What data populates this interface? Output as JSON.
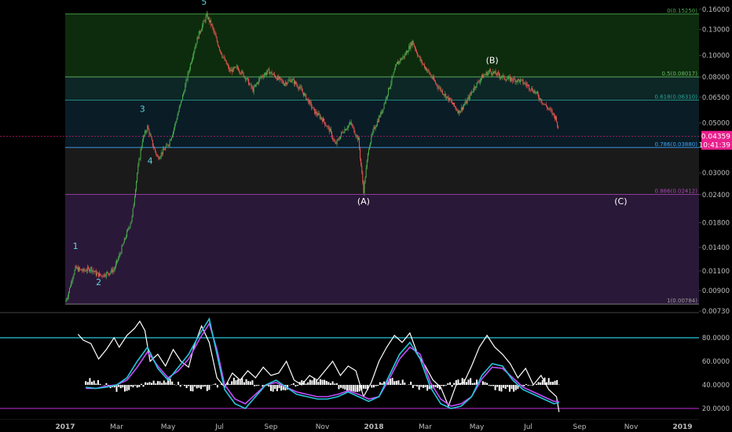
{
  "chart_data": [
    {
      "type": "candlestick",
      "scale": "log",
      "ylim": [
        0.0073,
        0.165
      ],
      "y_ticks": [
        "0.16000",
        "0.13000",
        "0.10000",
        "0.08000",
        "0.06500",
        "0.05000",
        "0.03900",
        "0.03000",
        "0.02400",
        "0.01800",
        "0.01400",
        "0.01100",
        "0.00900",
        "0.00730"
      ],
      "y_tick_values": [
        0.16,
        0.13,
        0.1,
        0.08,
        0.065,
        0.05,
        0.039,
        0.03,
        0.024,
        0.018,
        0.014,
        0.011,
        0.009,
        0.0073
      ],
      "x_ticks": [
        "2017",
        "Mar",
        "May",
        "Jul",
        "Sep",
        "Nov",
        "2018",
        "Mar",
        "May",
        "Jul",
        "Sep",
        "Nov",
        "2019"
      ],
      "x_tick_months": [
        0,
        2,
        4,
        6,
        8,
        10,
        12,
        14,
        16,
        18,
        20,
        22,
        24
      ],
      "price_path": [
        [
          0,
          0.008
        ],
        [
          0.1,
          0.0086
        ],
        [
          0.3,
          0.0105
        ],
        [
          0.4,
          0.0113
        ],
        [
          0.7,
          0.011
        ],
        [
          1.0,
          0.0113
        ],
        [
          1.2,
          0.0107
        ],
        [
          1.4,
          0.0105
        ],
        [
          1.7,
          0.0108
        ],
        [
          1.9,
          0.0112
        ],
        [
          2.1,
          0.0128
        ],
        [
          2.3,
          0.015
        ],
        [
          2.6,
          0.019
        ],
        [
          2.8,
          0.03
        ],
        [
          3.0,
          0.042
        ],
        [
          3.2,
          0.048
        ],
        [
          3.4,
          0.04
        ],
        [
          3.6,
          0.035
        ],
        [
          3.8,
          0.0375
        ],
        [
          4.0,
          0.04
        ],
        [
          4.2,
          0.046
        ],
        [
          4.4,
          0.056
        ],
        [
          4.6,
          0.068
        ],
        [
          4.8,
          0.085
        ],
        [
          5.0,
          0.105
        ],
        [
          5.2,
          0.125
        ],
        [
          5.5,
          0.15
        ],
        [
          5.7,
          0.135
        ],
        [
          5.9,
          0.115
        ],
        [
          6.1,
          0.1
        ],
        [
          6.4,
          0.085
        ],
        [
          6.7,
          0.088
        ],
        [
          7.0,
          0.08
        ],
        [
          7.3,
          0.07
        ],
        [
          7.6,
          0.08
        ],
        [
          7.9,
          0.085
        ],
        [
          8.2,
          0.08
        ],
        [
          8.5,
          0.075
        ],
        [
          8.8,
          0.078
        ],
        [
          9.1,
          0.072
        ],
        [
          9.4,
          0.064
        ],
        [
          9.7,
          0.056
        ],
        [
          10.0,
          0.052
        ],
        [
          10.3,
          0.046
        ],
        [
          10.5,
          0.04
        ],
        [
          10.8,
          0.046
        ],
        [
          11.1,
          0.05
        ],
        [
          11.4,
          0.042
        ],
        [
          11.6,
          0.025
        ],
        [
          11.8,
          0.039
        ],
        [
          12.0,
          0.047
        ],
        [
          12.3,
          0.056
        ],
        [
          12.6,
          0.072
        ],
        [
          12.9,
          0.092
        ],
        [
          13.2,
          0.1
        ],
        [
          13.5,
          0.115
        ],
        [
          13.8,
          0.095
        ],
        [
          14.1,
          0.085
        ],
        [
          14.4,
          0.075
        ],
        [
          14.7,
          0.068
        ],
        [
          15.0,
          0.062
        ],
        [
          15.3,
          0.056
        ],
        [
          15.6,
          0.062
        ],
        [
          15.9,
          0.072
        ],
        [
          16.2,
          0.08
        ],
        [
          16.5,
          0.085
        ],
        [
          16.8,
          0.082
        ],
        [
          17.1,
          0.079
        ],
        [
          17.4,
          0.078
        ],
        [
          17.7,
          0.077
        ],
        [
          18.0,
          0.073
        ],
        [
          18.3,
          0.068
        ],
        [
          18.6,
          0.061
        ],
        [
          18.9,
          0.056
        ],
        [
          19.1,
          0.052
        ],
        [
          19.2,
          0.0436
        ]
      ]
    },
    {
      "type": "line",
      "ylim": [
        12,
        100
      ],
      "y_ticks": [
        "80.0000",
        "60.0000",
        "40.0000",
        "20.0000"
      ],
      "y_tick_values": [
        80,
        60,
        40,
        20
      ],
      "hlines": [
        80,
        20
      ],
      "series": [
        {
          "color": "#ffffff",
          "months": [
            0.5,
            0.7,
            1.0,
            1.3,
            1.6,
            1.9,
            2.1,
            2.4,
            2.7,
            2.9,
            3.1,
            3.3,
            3.6,
            3.9,
            4.2,
            4.5,
            4.8,
            5.0,
            5.3,
            5.6,
            5.9,
            6.2,
            6.5,
            6.8,
            7.1,
            7.4,
            7.7,
            8.0,
            8.3,
            8.6,
            8.9,
            9.2,
            9.5,
            9.8,
            10.1,
            10.4,
            10.7,
            11.0,
            11.3,
            11.6,
            11.9,
            12.2,
            12.5,
            12.8,
            13.1,
            13.4,
            13.7,
            14.0,
            14.3,
            14.6,
            14.9,
            15.2,
            15.5,
            15.8,
            16.1,
            16.4,
            16.7,
            17.0,
            17.3,
            17.6,
            17.9,
            18.2,
            18.5,
            18.8,
            19.1,
            19.2
          ],
          "values": [
            83,
            78,
            75,
            62,
            70,
            80,
            72,
            82,
            88,
            94,
            86,
            60,
            66,
            56,
            70,
            60,
            55,
            72,
            90,
            76,
            46,
            38,
            50,
            44,
            52,
            46,
            55,
            48,
            50,
            60,
            44,
            40,
            48,
            44,
            52,
            60,
            48,
            56,
            52,
            30,
            42,
            60,
            72,
            82,
            76,
            84,
            66,
            56,
            44,
            38,
            22,
            40,
            42,
            56,
            72,
            82,
            72,
            66,
            58,
            46,
            54,
            40,
            48,
            36,
            30,
            17
          ]
        },
        {
          "color": "#c44dff",
          "months": [
            0.8,
            1.2,
            1.6,
            2.0,
            2.4,
            2.8,
            3.2,
            3.6,
            4.0,
            4.4,
            4.8,
            5.2,
            5.6,
            5.9,
            6.2,
            6.6,
            7.0,
            7.4,
            7.8,
            8.2,
            8.6,
            9.0,
            9.4,
            9.8,
            10.2,
            10.6,
            11.0,
            11.4,
            11.8,
            12.2,
            12.6,
            13.0,
            13.4,
            13.8,
            14.2,
            14.6,
            15.0,
            15.4,
            15.8,
            16.2,
            16.6,
            17.0,
            17.4,
            17.8,
            18.2,
            18.6,
            19.0,
            19.2
          ],
          "values": [
            37,
            37,
            39,
            40,
            44,
            55,
            68,
            56,
            46,
            52,
            62,
            78,
            92,
            70,
            40,
            28,
            24,
            32,
            40,
            42,
            38,
            34,
            32,
            30,
            30,
            32,
            35,
            32,
            28,
            30,
            45,
            62,
            72,
            66,
            42,
            28,
            22,
            24,
            30,
            45,
            55,
            54,
            46,
            38,
            34,
            30,
            26,
            26
          ]
        },
        {
          "color": "#26c6da",
          "months": [
            0.8,
            1.2,
            1.6,
            2.0,
            2.4,
            2.8,
            3.2,
            3.6,
            4.0,
            4.4,
            4.8,
            5.2,
            5.6,
            5.9,
            6.2,
            6.6,
            7.0,
            7.4,
            7.8,
            8.2,
            8.6,
            9.0,
            9.4,
            9.8,
            10.2,
            10.6,
            11.0,
            11.4,
            11.8,
            12.2,
            12.6,
            13.0,
            13.4,
            13.8,
            14.2,
            14.6,
            15.0,
            15.4,
            15.8,
            16.2,
            16.6,
            17.0,
            17.4,
            17.8,
            18.2,
            18.6,
            19.0,
            19.2
          ],
          "values": [
            38,
            37,
            38,
            40,
            46,
            60,
            72,
            54,
            44,
            55,
            66,
            82,
            96,
            66,
            36,
            24,
            20,
            30,
            40,
            44,
            38,
            32,
            30,
            28,
            28,
            30,
            34,
            30,
            26,
            30,
            48,
            66,
            76,
            62,
            38,
            24,
            20,
            22,
            30,
            48,
            58,
            56,
            44,
            36,
            32,
            28,
            24,
            25
          ]
        }
      ]
    }
  ],
  "fib_levels": [
    {
      "ratio": "0",
      "value": 0.1525,
      "label": "0(0.15250)",
      "color": "#4caf50"
    },
    {
      "ratio": "0.5",
      "value": 0.0801,
      "label": "0.5(0.08017)",
      "color": "#66bb6a"
    },
    {
      "ratio": "0.618",
      "value": 0.0631,
      "label": "0.618(0.06310)",
      "color": "#26a69a"
    },
    {
      "ratio": "0.786",
      "value": 0.0389,
      "label": "0.786(0.03880)",
      "color": "#42a5f5"
    },
    {
      "ratio": "0.886",
      "value": 0.0241,
      "label": "0.886(0.02412)",
      "color": "#ab47bc"
    },
    {
      "ratio": "1",
      "value": 0.00784,
      "label": "1(0.00784)",
      "color": "#9e9e9e"
    }
  ],
  "fib_zone_colors": [
    "#0d2b0d",
    "#0d2626",
    "#0a1c26",
    "#1a1a1a",
    "#2a1838"
  ],
  "wave_labels": [
    {
      "text": "1",
      "month": 0.4,
      "value": 0.0138,
      "color": "#5fd3e0"
    },
    {
      "text": "2",
      "month": 1.3,
      "value": 0.0095,
      "color": "#5fd3e0"
    },
    {
      "text": "3",
      "month": 3.0,
      "value": 0.056,
      "color": "#5fd3e0"
    },
    {
      "text": "4",
      "month": 3.3,
      "value": 0.033,
      "color": "#5fd3e0"
    },
    {
      "text": "5",
      "month": 5.4,
      "value": 0.168,
      "color": "#5fd3e0"
    },
    {
      "text": "(A)",
      "month": 11.6,
      "value": 0.0218,
      "color": "#ffffff"
    },
    {
      "text": "(B)",
      "month": 16.6,
      "value": 0.092,
      "color": "#ffffff"
    },
    {
      "text": "(C)",
      "month": 21.6,
      "value": 0.0218,
      "color": "#ffffff"
    }
  ],
  "price_tag": {
    "price": "0.04359",
    "time": "10:41:39",
    "value": 0.04359,
    "color": "#e91e8c"
  },
  "colors": {
    "up": "#4caf50",
    "down": "#ef5350",
    "axis_text": "#bdbdbd",
    "hist": "#ffffff"
  }
}
